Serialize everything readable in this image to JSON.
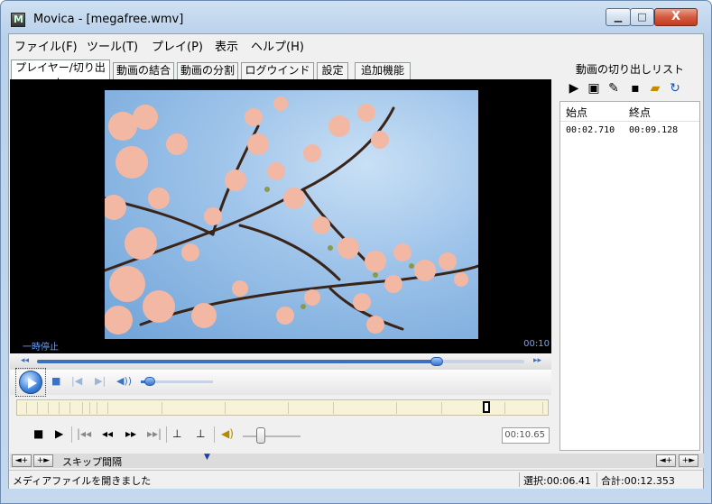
{
  "window": {
    "title": "Movica - [megafree.wmv]",
    "controls": {
      "minimize": "▁",
      "maximize": "□",
      "close": "X"
    }
  },
  "menubar": [
    "ファイル(F)",
    "ツール(T)",
    "プレイ(P)",
    "表示",
    "ヘルプ(H)"
  ],
  "tabs": [
    "プレイヤー/切り出し",
    "動画の結合",
    "動画の分割",
    "ログウインドウ",
    "設定",
    "追加機能"
  ],
  "cut_list": {
    "title": "動画の切り出しリスト",
    "toolbar_icons": [
      "play-icon",
      "preview-icon",
      "edit-icon",
      "save-icon",
      "open-folder-icon",
      "refresh-icon"
    ],
    "columns": [
      "始点",
      "終点"
    ],
    "rows": [
      {
        "start": "00:02.710",
        "end": "00:09.128"
      }
    ]
  },
  "player": {
    "status": "一時停止",
    "time": "00:10",
    "seek_position": 0.82,
    "volume_level": 0.12
  },
  "edit_bar": {
    "time_value": "00:10.65",
    "volume_level": 0.3
  },
  "skip": {
    "label": "スキップ間隔"
  },
  "statusbar": {
    "message": "メディアファイルを開きました",
    "selection": "選択:00:06.41",
    "total": "合計:00:12.353"
  },
  "colors": {
    "accent": "#3a72c8",
    "timeline_bg": "#f7f3d8"
  }
}
